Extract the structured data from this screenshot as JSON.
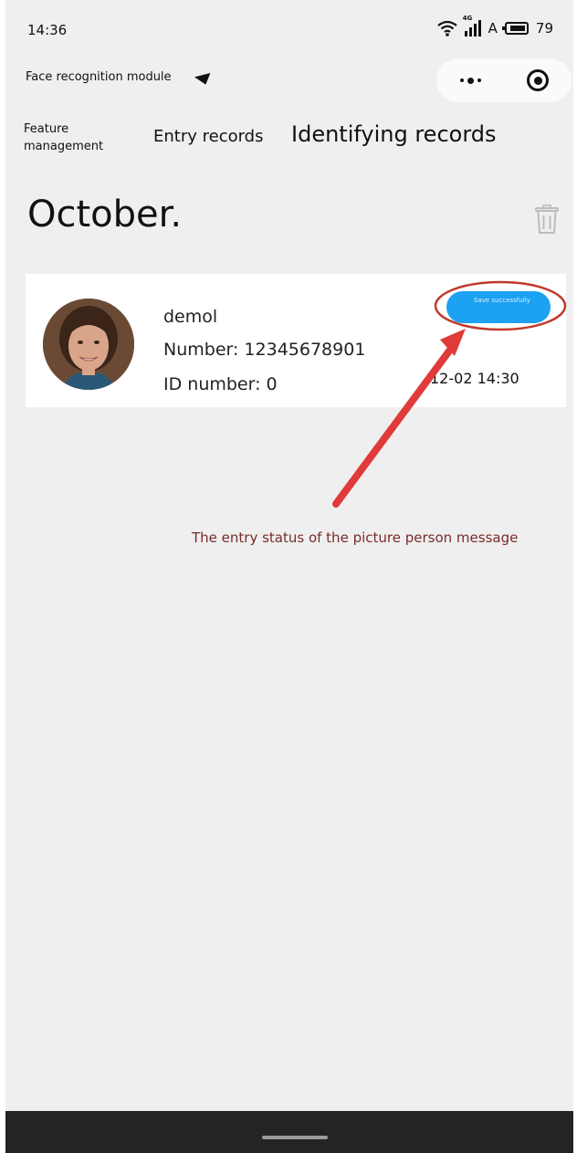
{
  "status_bar": {
    "time": "14:36",
    "network_tag": "4G",
    "carrier_letter": "A",
    "battery": "79"
  },
  "navbar": {
    "title": "Face recognition module"
  },
  "tabs": [
    {
      "label": "Feature management"
    },
    {
      "label": "Entry records"
    },
    {
      "label": "Identifying records"
    }
  ],
  "month": "October.",
  "record": {
    "name": "demol",
    "number": "Number: 12345678901",
    "id_number": "ID number: 0",
    "status": "Save successfully",
    "time": "12-02 14:30"
  },
  "annotation": {
    "text": "The entry status of the picture person message"
  },
  "colors": {
    "status_pill": "#1da1f2",
    "annotation_arrow": "#e03a3a",
    "annotation_circle": "#c0392b",
    "page_bg": "#efefef"
  }
}
